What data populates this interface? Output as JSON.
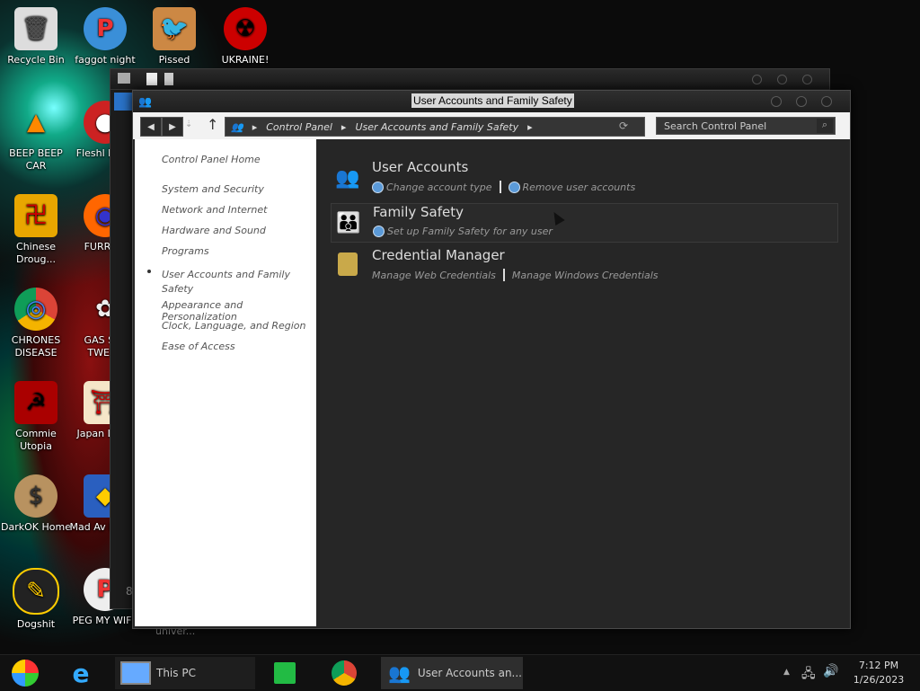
{
  "desktop": {
    "icons": [
      {
        "label": "Recycle Bin",
        "glyph": "🗑"
      },
      {
        "label": "faggot night",
        "glyph": "P"
      },
      {
        "label": "Pissed",
        "glyph": "🐦"
      },
      {
        "label": "UKRAINE!",
        "glyph": "☢"
      },
      {
        "label": "BEEP BEEP CAR",
        "glyph": "▲"
      },
      {
        "label": "Fleshl DELU",
        "glyph": "●"
      },
      {
        "label": "Chinese Droug...",
        "glyph": "卍"
      },
      {
        "label": "FURRY C",
        "glyph": "◉"
      },
      {
        "label": "CHRONES DISEASE",
        "glyph": "◎"
      },
      {
        "label": "GAS STA TWEAK",
        "glyph": "✿"
      },
      {
        "label": "Commie Utopia",
        "glyph": "☭"
      },
      {
        "label": "Japan Loli P",
        "glyph": "⛩"
      },
      {
        "label": "DarkOK Home",
        "glyph": "$"
      },
      {
        "label": "Mad Av IN SPA",
        "glyph": "◆"
      },
      {
        "label": "Dogshit",
        "glyph": "✎"
      },
      {
        "label": "PEG MY WIFE",
        "glyph": "P"
      }
    ],
    "bg_window_fragment": "univer...",
    "bg_window_digit": "8"
  },
  "window": {
    "title": "User Accounts and Family Safety",
    "breadcrumb": [
      "Control Panel",
      "User Accounts and Family Safety"
    ],
    "search_placeholder": "Search Control Panel",
    "sidebar": {
      "home": "Control Panel Home",
      "links": [
        "System and Security",
        "Network and Internet",
        "Hardware and Sound",
        "Programs",
        "User Accounts and Family Safety",
        "Appearance and Personalization",
        "Clock, Language, and Region",
        "Ease of Access"
      ],
      "active_index": 4
    },
    "categories": [
      {
        "title": "User Accounts",
        "icon": "users-icon",
        "links": [
          "Change account type",
          "Remove user accounts"
        ]
      },
      {
        "title": "Family Safety",
        "icon": "family-icon",
        "links": [
          "Set up Family Safety for any user"
        ]
      },
      {
        "title": "Credential Manager",
        "icon": "vault-icon",
        "links": [
          "Manage Web Credentials",
          "Manage Windows Credentials"
        ]
      }
    ]
  },
  "taskbar": {
    "this_pc": "This PC",
    "active_window": "User Accounts an...",
    "time": "7:12 PM",
    "date": "1/26/2023"
  }
}
